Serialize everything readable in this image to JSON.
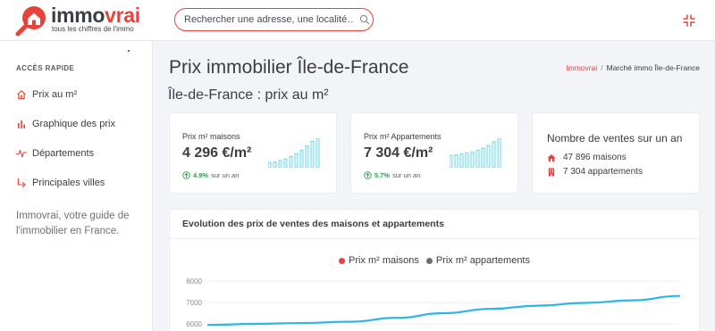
{
  "brand": {
    "name_part1": "immo",
    "name_part2": "vrai",
    "tagline": "tous les chiffres de l'immo",
    "accent": "#e5433c"
  },
  "search": {
    "placeholder": "Rechercher une adresse, une localité…",
    "icon": "search-icon"
  },
  "header": {
    "collapse_icon": "collapse-icon"
  },
  "sidebar": {
    "section_label": "ACCÈS RAPIDE",
    "items": [
      {
        "label": "Prix au m²",
        "icon": "home-icon"
      },
      {
        "label": "Graphique des prix",
        "icon": "bar-chart-icon"
      },
      {
        "label": "Départements",
        "icon": "pulse-icon"
      },
      {
        "label": "Principales villes",
        "icon": "arrow-turn-icon"
      }
    ],
    "blurb": "Immovrai, votre guide de l'immobilier en France."
  },
  "main": {
    "title": "Prix immobilier Île-de-France",
    "breadcrumb": {
      "home": "Immovrai",
      "separator": "/",
      "current": "Marché immo Île-de-France"
    },
    "section_title": "Île-de-France : prix au m²"
  },
  "cards": {
    "houses": {
      "label": "Prix m² maisons",
      "value": "4 296 €/m²",
      "trend_pct": "4.9%",
      "trend_text": "sur un an",
      "spark_levels": [
        0.18,
        0.2,
        0.25,
        0.3,
        0.38,
        0.48,
        0.6,
        0.75,
        0.9,
        1.0
      ]
    },
    "apartments": {
      "label": "Prix m² Appartements",
      "value": "7 304 €/m²",
      "trend_pct": "5.7%",
      "trend_text": "sur un an",
      "spark_levels": [
        0.42,
        0.44,
        0.47,
        0.5,
        0.54,
        0.6,
        0.67,
        0.76,
        0.88,
        1.0
      ]
    },
    "sales": {
      "title": "Nombre de ventes sur un an",
      "houses": "47 896 maisons",
      "apartments": "7 304 appartements"
    }
  },
  "chart_section": {
    "title": "Evolution des prix de ventes des maisons et appartements",
    "legend": [
      {
        "label": "Prix m² maisons",
        "color": "#e5433c"
      },
      {
        "label": "Prix m² appartements",
        "color": "#6b6e74"
      }
    ]
  },
  "chart_data": {
    "type": "line",
    "title": "",
    "xlabel": "",
    "ylabel": "",
    "y_ticks": [
      "8000",
      "7000",
      "6000"
    ],
    "ylim": [
      5500,
      8000
    ],
    "x": [
      0,
      1,
      2,
      3,
      4,
      5,
      6,
      7,
      8,
      9,
      10
    ],
    "series": [
      {
        "name": "Prix m² appartements",
        "color": "#2bb5e8",
        "values": [
          5950,
          6000,
          6040,
          6100,
          6280,
          6500,
          6700,
          6850,
          6980,
          7100,
          7304
        ]
      }
    ]
  }
}
